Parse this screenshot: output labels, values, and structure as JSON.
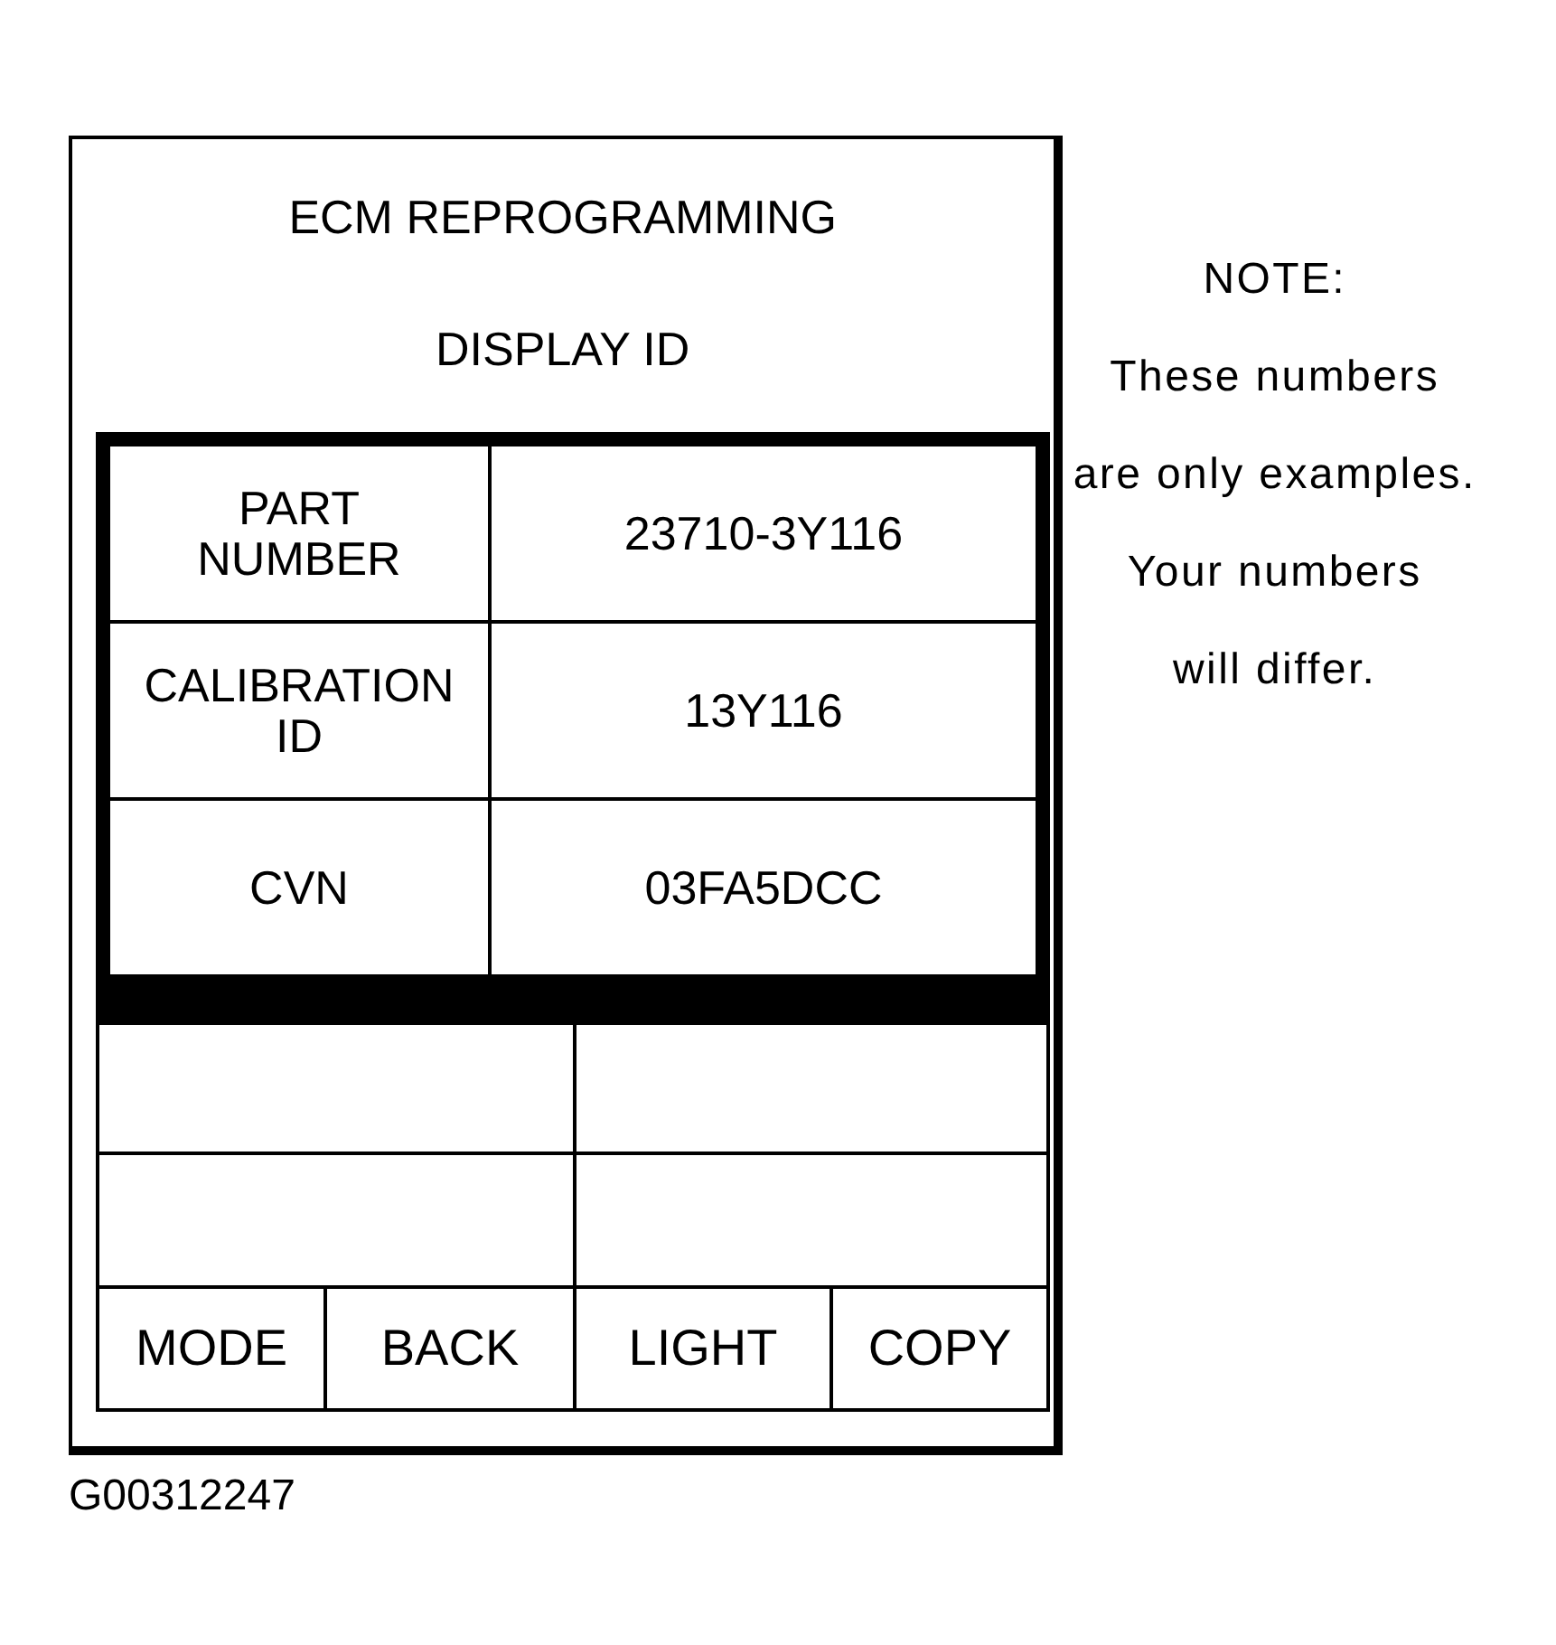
{
  "screen": {
    "title": "ECM REPROGRAMMING",
    "subtitle": "DISPLAY ID",
    "id_table": [
      {
        "label": "PART\nNUMBER",
        "value": "23710-3Y116"
      },
      {
        "label": "CALIBRATION\nID",
        "value": "13Y116"
      },
      {
        "label": "CVN",
        "value": "03FA5DCC"
      }
    ],
    "soft_keys": [
      "MODE",
      "BACK",
      "LIGHT",
      "COPY"
    ]
  },
  "note": {
    "heading": "NOTE:",
    "text": "These numbers\nare only examples.\nYour numbers\nwill differ."
  },
  "figure_id": "G00312247"
}
